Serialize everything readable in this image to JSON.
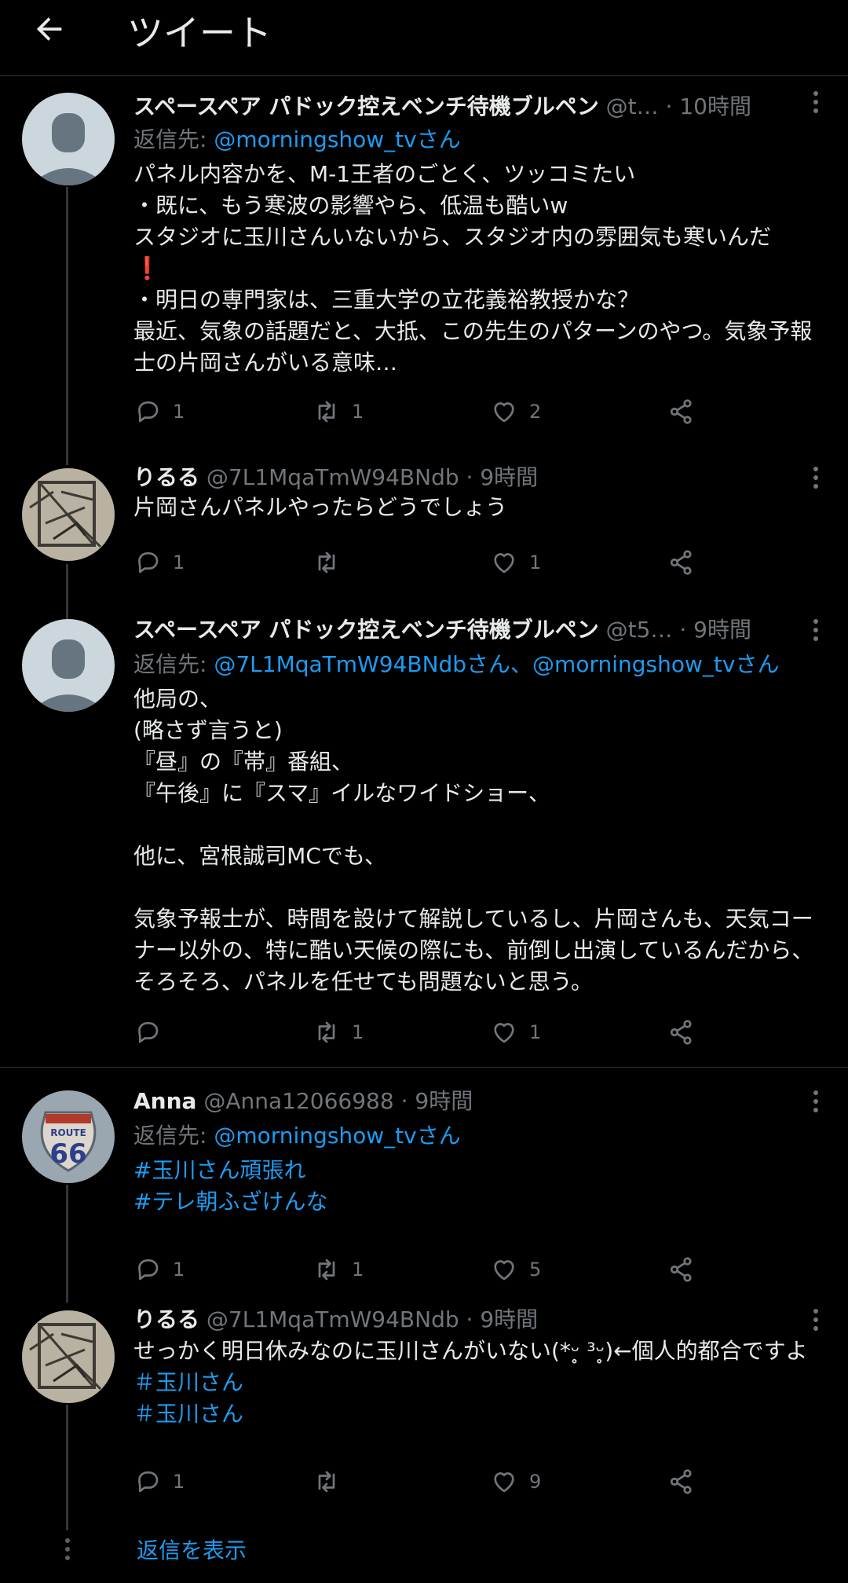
{
  "header": {
    "title": "ツイート"
  },
  "tweets": [
    {
      "name": "スペースペア パドック控えベンチ待機ブルペン",
      "handle": "@t…",
      "time": "10時間",
      "reply_label": "返信先:",
      "reply_to": "@morningshow_tvさん",
      "body": "パネル内容かを、M-1王者のごとく、ツッコミたい\n・既に、もう寒波の影響やら、低温も酷いw\nスタジオに玉川さんいないから、スタジオ内の雰囲気も寒いんだ\n❗\n・明日の専門家は、三重大学の立花義裕教授かな？\n最近、気象の話題だと、大抵、この先生のパターンのやつ。気象予報士の片岡さんがいる意味…",
      "replies": "1",
      "retweets": "1",
      "likes": "2"
    },
    {
      "name": "りるる",
      "handle": "@7L1MqaTmW94BNdb",
      "time": "9時間",
      "body": "片岡さんパネルやったらどうでしょう",
      "replies": "1",
      "retweets": "",
      "likes": "1"
    },
    {
      "name": "スペースペア パドック控えベンチ待機ブルペン",
      "handle": "@t5…",
      "time": "9時間",
      "reply_label": "返信先:",
      "reply_to": "@7L1MqaTmW94BNdbさん、@morningshow_tvさん",
      "body": "他局の、\n(略さず言うと)\n『昼』の『帯』番組、\n『午後』に『スマ』イルなワイドショー、\n\n他に、宮根誠司MCでも、\n\n気象予報士が、時間を設けて解説しているし、片岡さんも、天気コーナー以外の、特に酷い天候の際にも、前倒し出演しているんだから、そろそろ、パネルを任せても問題ないと思う。",
      "replies": "",
      "retweets": "1",
      "likes": "1"
    },
    {
      "name": "Anna",
      "handle": "@Anna12066988",
      "time": "9時間",
      "reply_label": "返信先:",
      "reply_to": "@morningshow_tvさん",
      "tags": [
        "#玉川さん頑張れ",
        "#テレ朝ふざけんな"
      ],
      "replies": "1",
      "retweets": "1",
      "likes": "5"
    },
    {
      "name": "りるる",
      "handle": "@7L1MqaTmW94BNdb",
      "time": "9時間",
      "body": "せっかく明日休みなのに玉川さんがいない(*ᵕ̥ ³ᵕ̥)←個人的都合ですよ",
      "tags": [
        "＃玉川さん",
        "＃玉川さん"
      ],
      "replies": "1",
      "retweets": "",
      "likes": "9"
    }
  ],
  "show_replies": "返信を表示",
  "colors": {
    "accent": "#1d9bf0",
    "muted": "#71767b",
    "background": "#000000"
  }
}
